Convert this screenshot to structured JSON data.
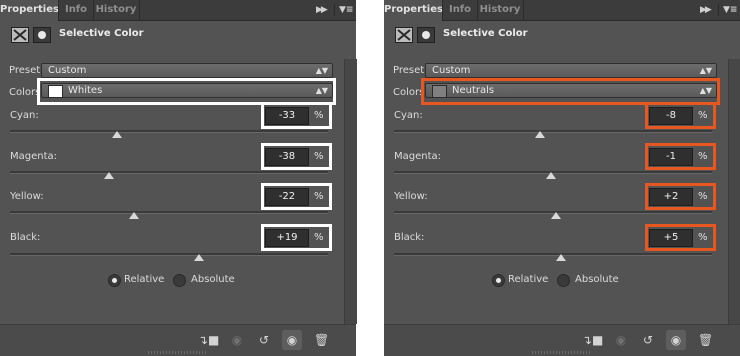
{
  "tabs": [
    "Properties",
    "Info",
    "History"
  ],
  "header_title": "Selective Color",
  "preset_label": "Preset:",
  "colors_label": "Colors",
  "percent_symbol": "%",
  "panels": [
    {
      "preset_value": "Custom",
      "colors_label": "Colors:",
      "colors_value": "Whites",
      "swatch_color": "#ffffff",
      "highlight_color": "#ffffff",
      "sliders": [
        {
          "label": "Cyan:",
          "value": "-33",
          "level_pct": -33
        },
        {
          "label": "Magenta:",
          "value": "-38",
          "level_pct": -38
        },
        {
          "label": "Yellow:",
          "value": "-22",
          "level_pct": -22
        },
        {
          "label": "Black:",
          "value": "+19",
          "level_pct": 19
        }
      ],
      "mode_selected": "Relative"
    },
    {
      "preset_value": "Custom",
      "colors_label": "Colors",
      "colors_value": "Neutrals",
      "swatch_color": "#808080",
      "highlight_color": "#e8571f",
      "sliders": [
        {
          "label": "Cyan:",
          "value": "-8",
          "level_pct": -8
        },
        {
          "label": "Magenta:",
          "value": "-1",
          "level_pct": -1
        },
        {
          "label": "Yellow:",
          "value": "+2",
          "level_pct": 2
        },
        {
          "label": "Black:",
          "value": "+5",
          "level_pct": 5
        }
      ],
      "mode_selected": "Relative"
    }
  ],
  "modes": [
    "Relative",
    "Absolute"
  ],
  "icons": {
    "collapse": "double-chevron-right-icon",
    "menu": "panel-menu-icon",
    "clip": "clip-to-layer-icon",
    "view_previous": "view-previous-state-icon",
    "reset": "reset-icon",
    "visibility": "eye-icon",
    "delete": "trash-icon"
  },
  "colors": {
    "panel_bg": "#535353",
    "tabbar_bg": "#3c3c3c",
    "field_bg": "#2f2f2f"
  }
}
